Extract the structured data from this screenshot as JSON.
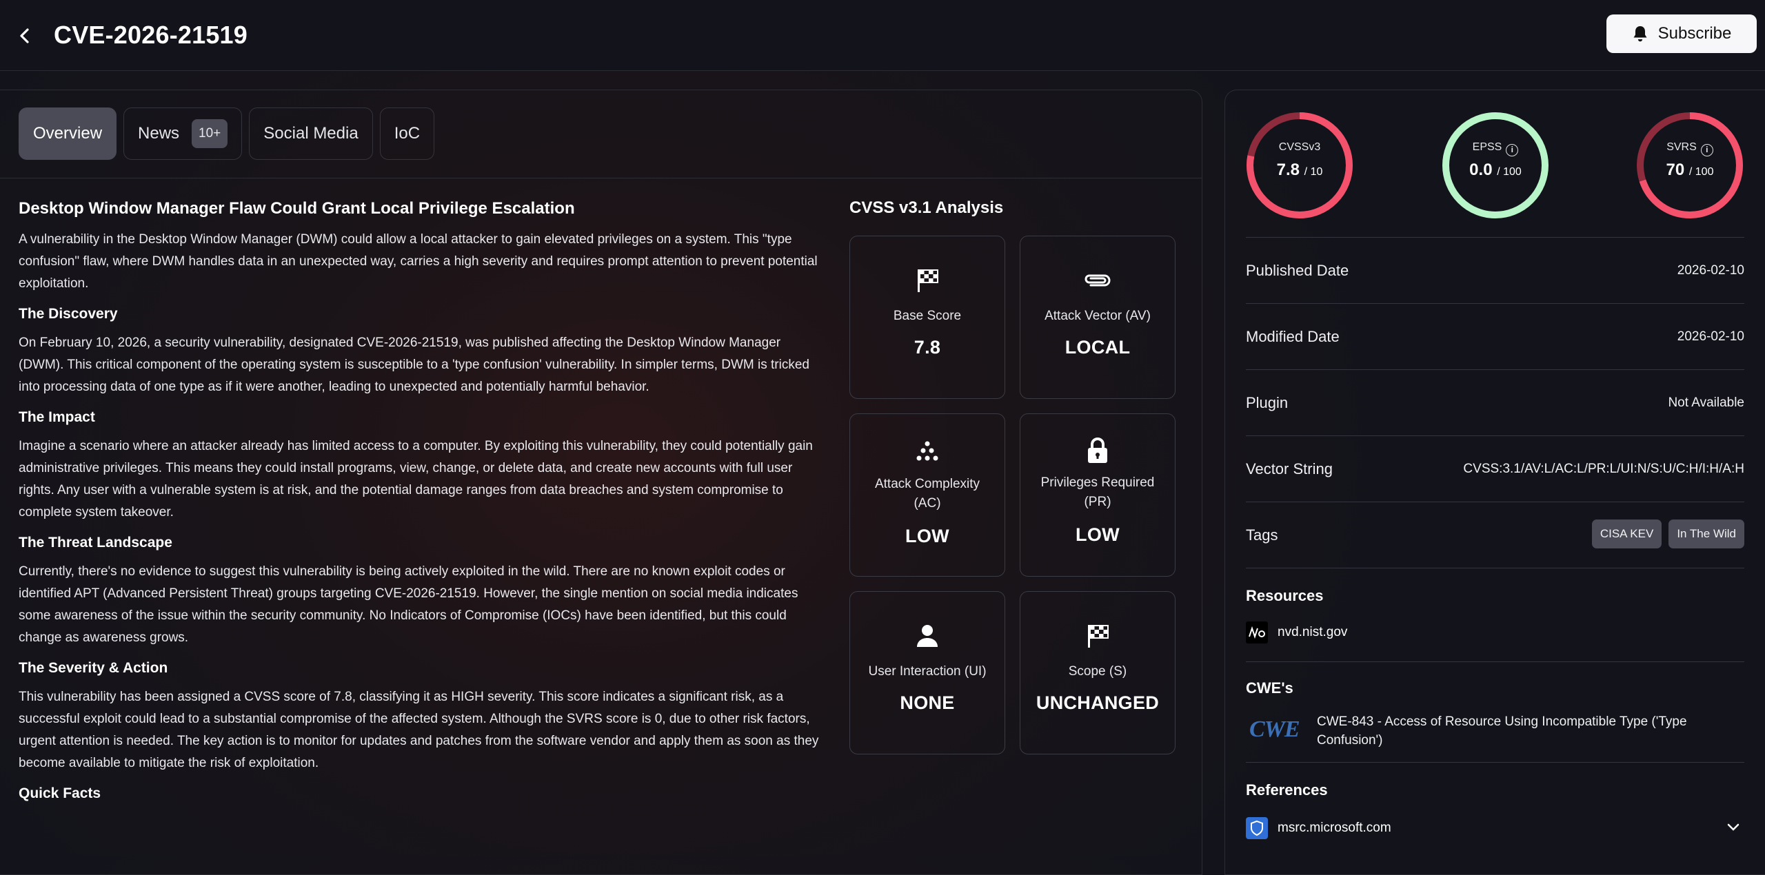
{
  "header": {
    "title": "CVE-2026-21519",
    "subscribe_label": "Subscribe"
  },
  "tabs": [
    {
      "label": "Overview",
      "active": true
    },
    {
      "label": "News",
      "badge": "10+"
    },
    {
      "label": "Social Media"
    },
    {
      "label": "IoC"
    }
  ],
  "article": {
    "title": "Desktop Window Manager Flaw Could Grant Local Privilege Escalation",
    "intro": "A vulnerability in the Desktop Window Manager (DWM) could allow a local attacker to gain elevated privileges on a system. This \"type confusion\" flaw, where DWM handles data in an unexpected way, carries a high severity and requires prompt attention to prevent potential exploitation.",
    "sections": [
      {
        "heading": "The Discovery",
        "body": "On February 10, 2026, a security vulnerability, designated CVE-2026-21519, was published affecting the Desktop Window Manager (DWM). This critical component of the operating system is susceptible to a 'type confusion' vulnerability. In simpler terms, DWM is tricked into processing data of one type as if it were another, leading to unexpected and potentially harmful behavior."
      },
      {
        "heading": "The Impact",
        "body": "Imagine a scenario where an attacker already has limited access to a computer. By exploiting this vulnerability, they could potentially gain administrative privileges. This means they could install programs, view, change, or delete data, and create new accounts with full user rights. Any user with a vulnerable system is at risk, and the potential damage ranges from data breaches and system compromise to complete system takeover."
      },
      {
        "heading": "The Threat Landscape",
        "body": "Currently, there's no evidence to suggest this vulnerability is being actively exploited in the wild. There are no known exploit codes or identified APT (Advanced Persistent Threat) groups targeting CVE-2026-21519. However, the single mention on social media indicates some awareness of the issue within the security community. No Indicators of Compromise (IOCs) have been identified, but this could change as awareness grows."
      },
      {
        "heading": "The Severity & Action",
        "body": "This vulnerability has been assigned a CVSS score of 7.8, classifying it as HIGH severity. This score indicates a significant risk, as a successful exploit could lead to a substantial compromise of the affected system. Although the SVRS score is 0, due to other risk factors, urgent attention is needed. The key action is to monitor for updates and patches from the software vendor and apply them as soon as they become available to mitigate the risk of exploitation."
      },
      {
        "heading": "Quick Facts",
        "body": ""
      }
    ]
  },
  "cvss": {
    "title": "CVSS v3.1 Analysis",
    "cards": [
      {
        "icon": "checkered-flag-icon",
        "label": "Base Score",
        "value": "7.8"
      },
      {
        "icon": "paperclip-icon",
        "label": "Attack Vector (AV)",
        "value": "LOCAL"
      },
      {
        "icon": "dots-cluster-icon",
        "label": "Attack Complexity (AC)",
        "value": "LOW"
      },
      {
        "icon": "lock-icon",
        "label": "Privileges Required (PR)",
        "value": "LOW"
      },
      {
        "icon": "user-icon",
        "label": "User Interaction (UI)",
        "value": "NONE"
      },
      {
        "icon": "checkered-flag-icon",
        "label": "Scope (S)",
        "value": "UNCHANGED"
      }
    ]
  },
  "scores": [
    {
      "label": "CVSSv3",
      "value": "7.8",
      "max": "/ 10",
      "fraction": 0.78,
      "color": "#f4516c",
      "info": false
    },
    {
      "label": "EPSS",
      "value": "0.0",
      "max": "/ 100",
      "fraction": 0.0,
      "color": "#b8f5c8",
      "info": true
    },
    {
      "label": "SVRS",
      "value": "70",
      "max": "/ 100",
      "fraction": 0.7,
      "color": "#f4516c",
      "info": true
    }
  ],
  "details": {
    "published": {
      "label": "Published Date",
      "value": "2026-02-10"
    },
    "modified": {
      "label": "Modified Date",
      "value": "2026-02-10"
    },
    "plugin": {
      "label": "Plugin",
      "value": "Not Available"
    },
    "vector": {
      "label": "Vector String",
      "value": "CVSS:3.1/AV:L/AC:L/PR:L/UI:N/S:U/C:H/I:H/A:H"
    },
    "tags_label": "Tags",
    "tags": [
      "CISA KEV",
      "In The Wild"
    ]
  },
  "resources": {
    "title": "Resources",
    "link": "nvd.nist.gov"
  },
  "cwes": {
    "title": "CWE's",
    "logo_text": "CWE",
    "item": "CWE-843 - Access of Resource Using Incompatible Type ('Type Confusion')"
  },
  "references": {
    "title": "References",
    "link": "msrc.microsoft.com"
  }
}
